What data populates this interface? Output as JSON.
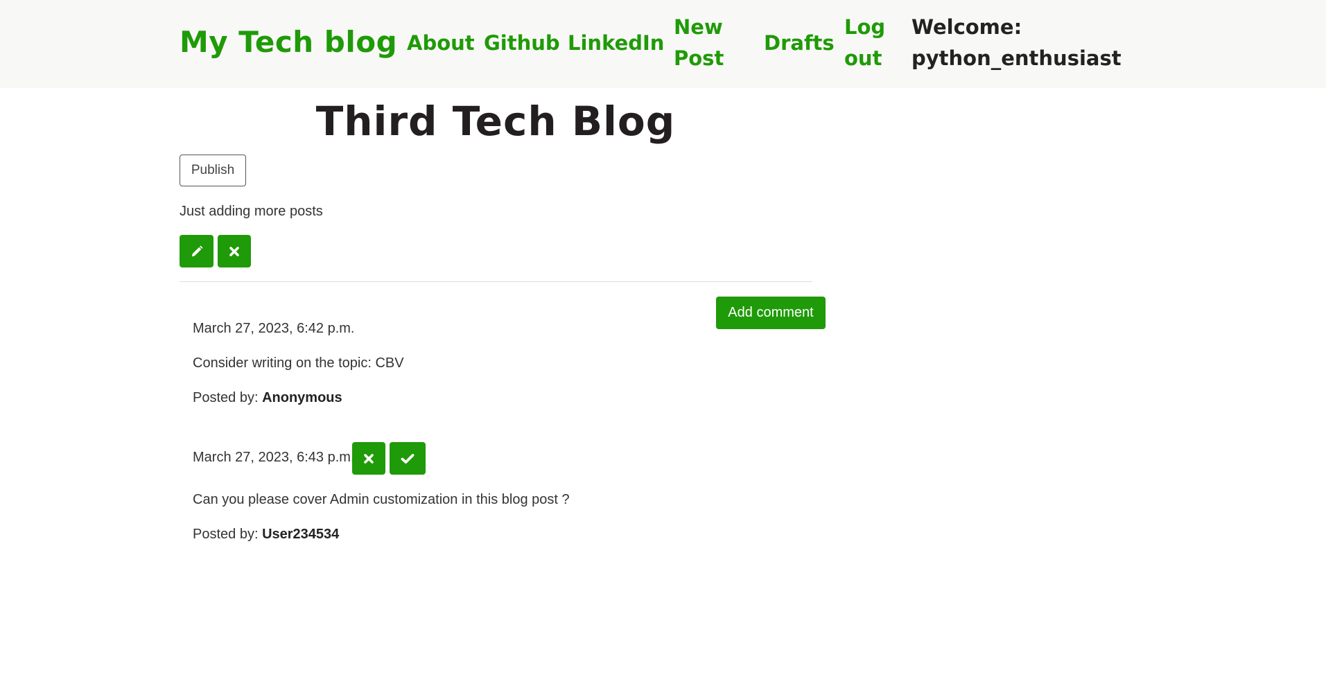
{
  "navbar": {
    "brand": "My Tech blog",
    "links": {
      "about": "About",
      "github": "Github",
      "linkedin": "LinkedIn",
      "new_post_line1": "New",
      "new_post_line2": "Post",
      "drafts": "Drafts",
      "logout_line1": "Log",
      "logout_line2": "out"
    },
    "welcome_label": "Welcome:",
    "username": "python_enthusiast"
  },
  "post": {
    "title": "Third Tech Blog",
    "publish_label": "Publish",
    "text": "Just adding more posts",
    "edit_icon": "pencil-icon",
    "delete_icon": "remove-icon"
  },
  "add_comment_label": "Add comment",
  "posted_by_label": "Posted by:",
  "comments": [
    {
      "date": "March 27, 2023, 6:42 p.m.",
      "text": "Consider writing on the topic: CBV",
      "author": "Anonymous"
    },
    {
      "date": "March 27, 2023, 6:43 p.m.",
      "text": "Can you please cover Admin customization in this blog post ?",
      "author": "User234534",
      "actions": [
        "remove-icon",
        "check-icon"
      ]
    }
  ],
  "colors": {
    "accent": "#1f9a08",
    "navbar_bg": "#f8f8f6",
    "title": "#231f20"
  }
}
